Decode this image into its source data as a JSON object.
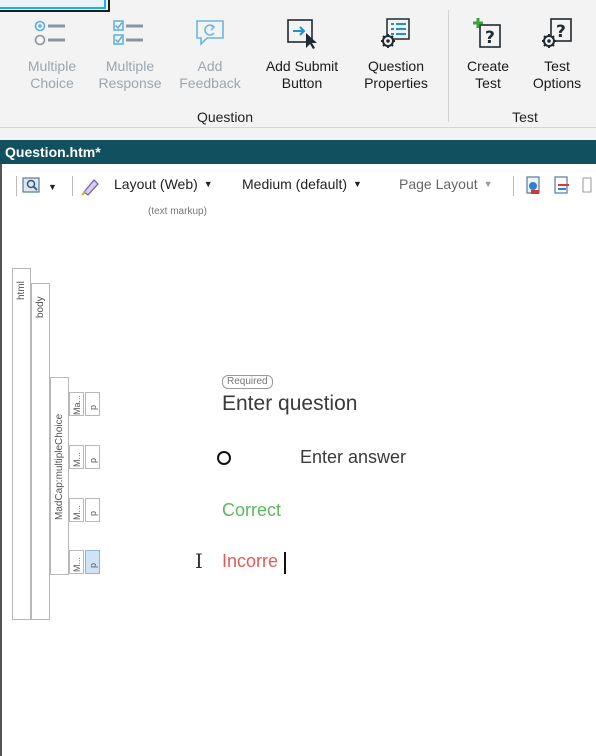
{
  "ribbon": {
    "buttons": [
      {
        "label_line1": "Multiple",
        "label_line2": "Choice",
        "icon": "multiple-choice-icon",
        "enabled": false
      },
      {
        "label_line1": "Multiple",
        "label_line2": "Response",
        "icon": "multiple-response-icon",
        "enabled": false
      },
      {
        "label_line1": "Add",
        "label_line2": "Feedback",
        "icon": "add-feedback-icon",
        "enabled": false
      },
      {
        "label_line1": "Add Submit",
        "label_line2": "Button",
        "icon": "add-submit-button-icon",
        "enabled": true
      },
      {
        "label_line1": "Question",
        "label_line2": "Properties",
        "icon": "question-properties-icon",
        "enabled": true
      },
      {
        "label_line1": "Create",
        "label_line2": "Test",
        "icon": "create-test-icon",
        "enabled": true
      },
      {
        "label_line1": "Test",
        "label_line2": "Options",
        "icon": "test-options-icon",
        "enabled": true
      }
    ],
    "groups": {
      "question": "Question",
      "test": "Test"
    }
  },
  "document": {
    "title": "Question.htm*"
  },
  "toolbar": {
    "layout": "Layout (Web)",
    "medium": "Medium (default)",
    "page_layout": "Page Layout",
    "hint": "(text markup)"
  },
  "structure": {
    "html": "html",
    "body": "body",
    "madcap": "MadCap:multipleChoice",
    "cells": [
      {
        "outer": "Ma...",
        "inner": "p"
      },
      {
        "outer": "M...",
        "inner": "p"
      },
      {
        "outer": "M...",
        "inner": "p"
      },
      {
        "outer": "M...",
        "inner": "p"
      }
    ]
  },
  "content": {
    "required": "Required",
    "question": "Enter question",
    "answer": "Enter answer",
    "correct": "Correct",
    "incorrect": "Incorre"
  },
  "colors": {
    "title_bar": "#11505e",
    "correct": "#5cb85c",
    "incorrect": "#e25b5b",
    "accent": "#19b2e8"
  }
}
